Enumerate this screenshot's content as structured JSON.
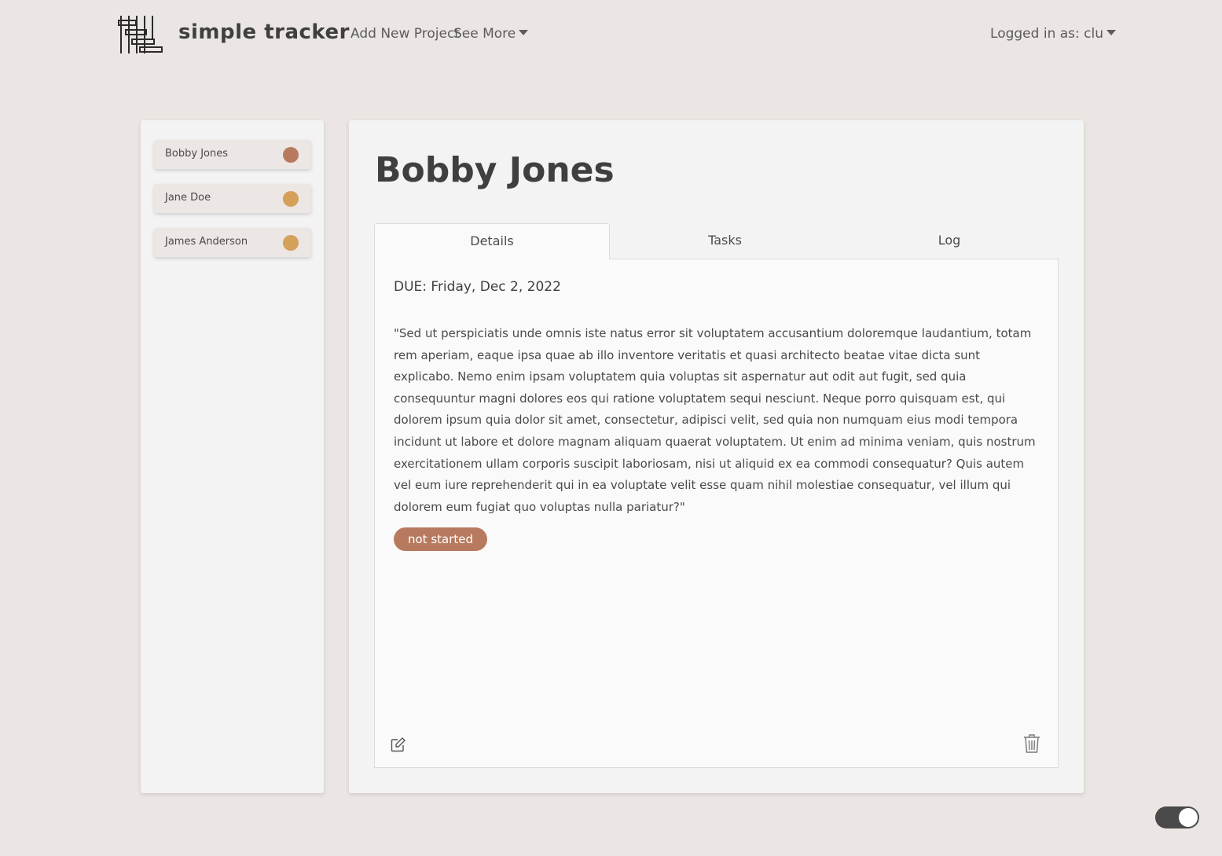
{
  "nav": {
    "brand": "simple tracker",
    "add_project": "Add New Project",
    "see_more": "See More",
    "user": "Logged in as: clu"
  },
  "sidebar": {
    "items": [
      {
        "name": "Bobby Jones",
        "status_color": "#b87a5e"
      },
      {
        "name": "Jane Doe",
        "status_color": "#d4a05a"
      },
      {
        "name": "James Anderson",
        "status_color": "#d4a05a"
      }
    ]
  },
  "project": {
    "title": "Bobby Jones",
    "tabs": [
      {
        "label": "Details",
        "active": true
      },
      {
        "label": "Tasks",
        "active": false
      },
      {
        "label": "Log",
        "active": false
      }
    ],
    "due": "DUE: Friday, Dec 2, 2022",
    "description": "\"Sed ut perspiciatis unde omnis iste natus error sit voluptatem accusantium doloremque laudantium, totam rem aperiam, eaque ipsa quae ab illo inventore veritatis et quasi architecto beatae vitae dicta sunt explicabo. Nemo enim ipsam voluptatem quia voluptas sit aspernatur aut odit aut fugit, sed quia consequuntur magni dolores eos qui ratione voluptatem sequi nesciunt. Neque porro quisquam est, qui dolorem ipsum quia dolor sit amet, consectetur, adipisci velit, sed quia non numquam eius modi tempora incidunt ut labore et dolore magnam aliquam quaerat voluptatem. Ut enim ad minima veniam, quis nostrum exercitationem ullam corporis suscipit laboriosam, nisi ut aliquid ex ea commodi consequatur? Quis autem vel eum iure reprehenderit qui in ea voluptate velit esse quam nihil molestiae consequatur, vel illum qui dolorem eum fugiat quo voluptas nulla pariatur?\"",
    "status": "not started",
    "status_color": "#b87a5e"
  },
  "icons": {
    "edit": "edit-icon",
    "trash": "trash-icon",
    "logo": "logo-icon"
  },
  "dark_mode_toggle": {
    "on": true
  }
}
